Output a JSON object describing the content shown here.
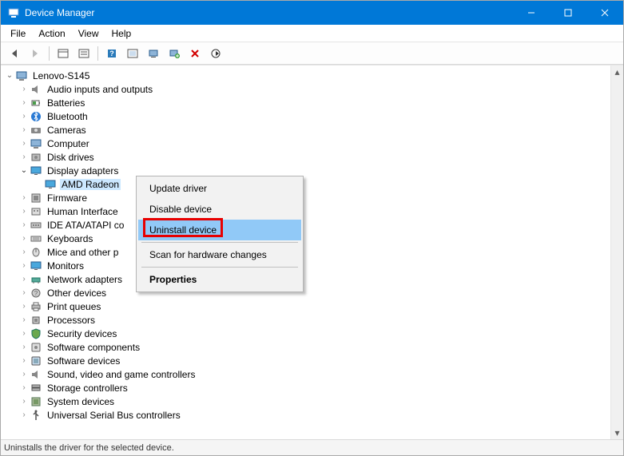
{
  "window": {
    "title": "Device Manager"
  },
  "menu": [
    "File",
    "Action",
    "View",
    "Help"
  ],
  "statusbar": "Uninstalls the driver for the selected device.",
  "root": {
    "name": "Lenovo-S145"
  },
  "categories": [
    {
      "label": "Audio inputs and outputs",
      "expanded": false,
      "icon": "audio"
    },
    {
      "label": "Batteries",
      "expanded": false,
      "icon": "battery"
    },
    {
      "label": "Bluetooth",
      "expanded": false,
      "icon": "bluetooth"
    },
    {
      "label": "Cameras",
      "expanded": false,
      "icon": "camera"
    },
    {
      "label": "Computer",
      "expanded": false,
      "icon": "computer"
    },
    {
      "label": "Disk drives",
      "expanded": false,
      "icon": "disk"
    },
    {
      "label": "Display adapters",
      "expanded": true,
      "icon": "display",
      "children": [
        {
          "label": "AMD Radeon",
          "icon": "display",
          "selected": true
        }
      ]
    },
    {
      "label": "Firmware",
      "expanded": false,
      "icon": "firmware"
    },
    {
      "label": "Human Interface",
      "expanded": false,
      "icon": "hid",
      "truncated": true,
      "fullLabelHint": "Human Interface Devices"
    },
    {
      "label": "IDE ATA/ATAPI co",
      "expanded": false,
      "icon": "ide",
      "truncated": true,
      "fullLabelHint": "IDE ATA/ATAPI controllers"
    },
    {
      "label": "Keyboards",
      "expanded": false,
      "icon": "keyboard"
    },
    {
      "label": "Mice and other p",
      "expanded": false,
      "icon": "mouse",
      "truncated": true,
      "fullLabelHint": "Mice and other pointing devices"
    },
    {
      "label": "Monitors",
      "expanded": false,
      "icon": "display"
    },
    {
      "label": "Network adapters",
      "expanded": false,
      "icon": "network"
    },
    {
      "label": "Other devices",
      "expanded": false,
      "icon": "other"
    },
    {
      "label": "Print queues",
      "expanded": false,
      "icon": "printer"
    },
    {
      "label": "Processors",
      "expanded": false,
      "icon": "cpu"
    },
    {
      "label": "Security devices",
      "expanded": false,
      "icon": "security"
    },
    {
      "label": "Software components",
      "expanded": false,
      "icon": "sw"
    },
    {
      "label": "Software devices",
      "expanded": false,
      "icon": "swdev"
    },
    {
      "label": "Sound, video and game controllers",
      "expanded": false,
      "icon": "audio"
    },
    {
      "label": "Storage controllers",
      "expanded": false,
      "icon": "storage"
    },
    {
      "label": "System devices",
      "expanded": false,
      "icon": "system"
    },
    {
      "label": "Universal Serial Bus controllers",
      "expanded": false,
      "icon": "usb",
      "truncated": true
    }
  ],
  "contextMenu": {
    "items": [
      {
        "label": "Update driver",
        "kind": "item"
      },
      {
        "label": "Disable device",
        "kind": "item"
      },
      {
        "label": "Uninstall device",
        "kind": "item",
        "highlighted": true,
        "redBox": true
      },
      {
        "kind": "sep"
      },
      {
        "label": "Scan for hardware changes",
        "kind": "item"
      },
      {
        "kind": "sep"
      },
      {
        "label": "Properties",
        "kind": "item",
        "bold": true
      }
    ]
  }
}
